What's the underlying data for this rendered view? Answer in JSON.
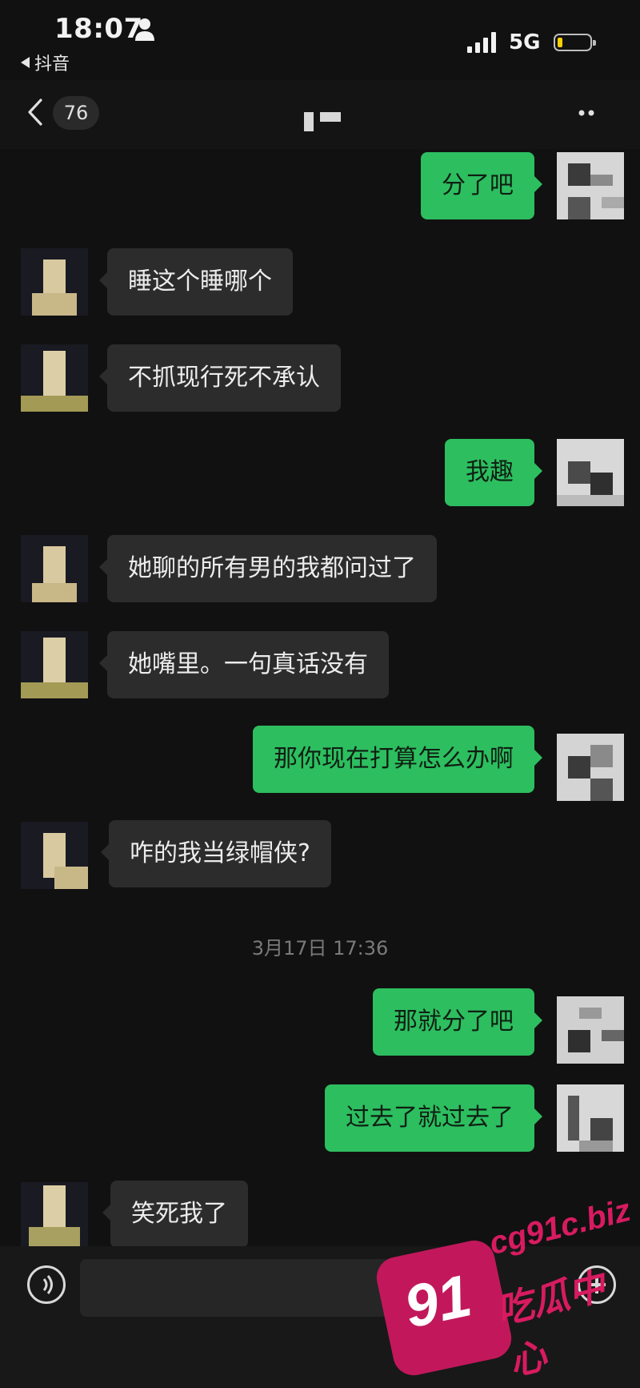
{
  "status_bar": {
    "time": "18:07",
    "back_app_label": "抖音",
    "network": "5G",
    "icons": [
      "person-icon",
      "signal-icon",
      "battery-icon"
    ],
    "battery_level": 0.12,
    "battery_color": "#f5d000"
  },
  "header": {
    "unread_count": "76",
    "icons": [
      "chevron-left-icon",
      "more-icon"
    ]
  },
  "colors": {
    "background": "#111111",
    "outgoing_bubble": "#2dbe60",
    "incoming_bubble": "#2c2c2c",
    "timestamp": "#7a7a7a"
  },
  "messages": [
    {
      "side": "out",
      "text": "分了吧"
    },
    {
      "side": "in",
      "text": "睡这个睡哪个"
    },
    {
      "side": "in",
      "text": "不抓现行死不承认"
    },
    {
      "side": "out",
      "text": "我趣"
    },
    {
      "side": "in",
      "text": "她聊的所有男的我都问过了"
    },
    {
      "side": "in",
      "text": "她嘴里。一句真话没有"
    },
    {
      "side": "out",
      "text": "那你现在打算怎么办啊"
    },
    {
      "side": "in",
      "text": "咋的我当绿帽侠?"
    },
    {
      "side": "out",
      "text": "那就分了吧"
    },
    {
      "side": "out",
      "text": "过去了就过去了"
    },
    {
      "side": "in",
      "text": "笑死我了"
    }
  ],
  "timestamp": "3月17日 17:36",
  "input_bar": {
    "icons": [
      "voice-icon",
      "plus-icon"
    ]
  },
  "watermark": {
    "number": "91",
    "url": "cg91c.biz",
    "text": "吃瓜中心"
  }
}
